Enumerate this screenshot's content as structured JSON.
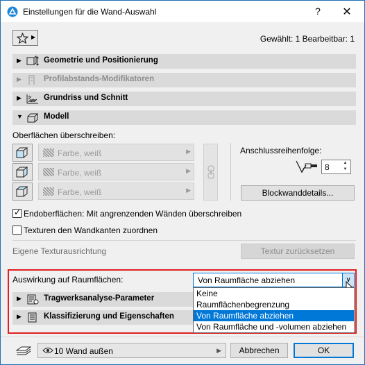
{
  "window": {
    "title": "Einstellungen für die Wand-Auswahl",
    "help": "?",
    "close": "✕"
  },
  "header": {
    "selected_info": "Gewählt: 1 Bearbeitbar: 1"
  },
  "sections": {
    "geometry": "Geometrie und Positionierung",
    "profile": "Profilabstands-Modifikatoren",
    "floorplan": "Grundriss und Schnitt",
    "model": "Modell",
    "structural": "Tragwerksanalyse-Parameter",
    "classification": "Klassifizierung und Eigenschaften"
  },
  "model": {
    "override_label": "Oberflächen überschreiben:",
    "surfaces": [
      "Farbe, weiß",
      "Farbe, weiß",
      "Farbe, weiß"
    ],
    "connection_label": "Anschlussreihenfolge:",
    "connection_value": "8",
    "block_button": "Blockwanddetails...",
    "end_surfaces_label": "Endoberflächen: Mit angrenzenden Wänden überschreiben",
    "end_surfaces_checked": true,
    "textures_label": "Texturen den Wandkanten zuordnen",
    "textures_checked": false,
    "texture_alignment_label": "Eigene Texturausrichtung",
    "reset_texture_button": "Textur zurücksetzen"
  },
  "zones": {
    "label": "Auswirkung auf Raumflächen:",
    "selected": "Von Raumfläche abziehen",
    "options": [
      "Keine",
      "Raumflächenbegrenzung",
      "Von Raumfläche abziehen",
      "Von Raumfläche und -volumen abziehen"
    ],
    "highlighted_index": 2
  },
  "footer": {
    "layer": "10 Wand außen",
    "cancel": "Abbrechen",
    "ok": "OK"
  },
  "colors": {
    "accent": "#0078d7",
    "highlight_box": "#e02020"
  }
}
